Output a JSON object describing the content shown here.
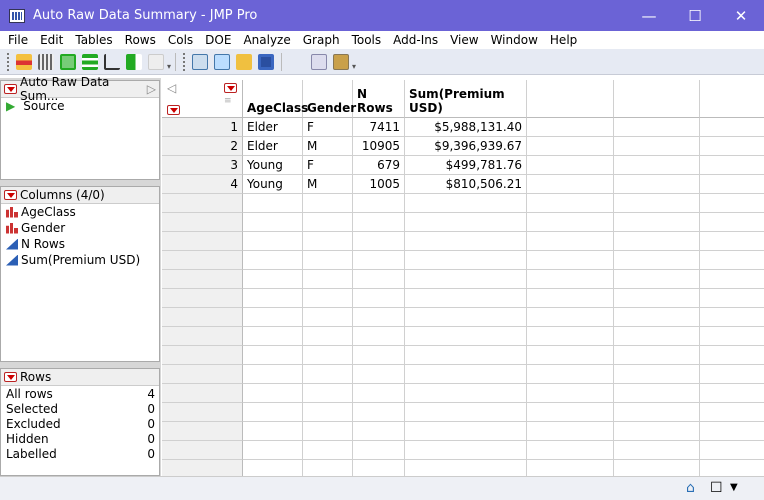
{
  "window": {
    "title": "Auto Raw Data Summary - JMP Pro",
    "minimize": "—",
    "maximize": "☐",
    "close": "✕"
  },
  "menu": [
    "File",
    "Edit",
    "Tables",
    "Rows",
    "Cols",
    "DOE",
    "Analyze",
    "Graph",
    "Tools",
    "Add-Ins",
    "View",
    "Window",
    "Help"
  ],
  "table_panel": {
    "title": "Auto Raw Data Sum...",
    "items": [
      "Source"
    ]
  },
  "columns_panel": {
    "title": "Columns (4/0)",
    "items": [
      {
        "name": "AgeClass",
        "type": "nominal"
      },
      {
        "name": "Gender",
        "type": "nominal"
      },
      {
        "name": "N Rows",
        "type": "continuous"
      },
      {
        "name": "Sum(Premium USD)",
        "type": "continuous"
      }
    ]
  },
  "rows_panel": {
    "title": "Rows",
    "items": [
      {
        "label": "All rows",
        "value": "4"
      },
      {
        "label": "Selected",
        "value": "0"
      },
      {
        "label": "Excluded",
        "value": "0"
      },
      {
        "label": "Hidden",
        "value": "0"
      },
      {
        "label": "Labelled",
        "value": "0"
      }
    ]
  },
  "table": {
    "headers": [
      "AgeClass",
      "Gender",
      "N Rows",
      "Sum(Premium USD)"
    ],
    "rows": [
      [
        "1",
        "Elder",
        "F",
        "7411",
        "$5,988,131.40"
      ],
      [
        "2",
        "Elder",
        "M",
        "10905",
        "$9,396,939.67"
      ],
      [
        "3",
        "Young",
        "F",
        "679",
        "$499,781.76"
      ],
      [
        "4",
        "Young",
        "M",
        "1005",
        "$810,506.21"
      ]
    ]
  },
  "status": {
    "home": "⌂",
    "box": "☐",
    "arrow": "▼"
  }
}
